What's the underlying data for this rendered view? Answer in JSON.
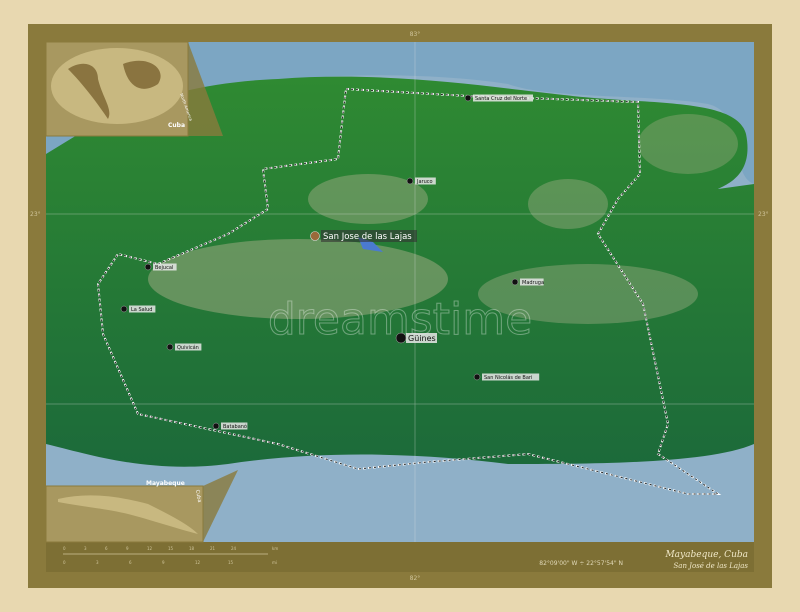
{
  "map": {
    "title": "Mayabeque, Cuba",
    "subtitle": "San José de las Lajas",
    "coordinates": "82°09'00\" W ÷ 22°57'54\" N",
    "capital": "San Jose de las Lajas",
    "cities": [
      {
        "name": "Santa Cruz del Norte"
      },
      {
        "name": "Jaruco"
      },
      {
        "name": "Bejucal"
      },
      {
        "name": "La Salud"
      },
      {
        "name": "Quivicán"
      },
      {
        "name": "Batabanó"
      },
      {
        "name": "Güines"
      },
      {
        "name": "Madruga"
      },
      {
        "name": "San Nicolás de Bari"
      }
    ],
    "ticks": {
      "top": "83°",
      "bottom": "82°",
      "left": "23°",
      "right": "23°"
    },
    "inset_world": {
      "label": "Cuba",
      "sublabel": "North America"
    },
    "inset_country": {
      "label": "Mayabeque",
      "sublabel": "Cuba"
    },
    "scale": {
      "km": [
        "0",
        "3",
        "6",
        "9",
        "12",
        "15",
        "18",
        "21",
        "24"
      ],
      "mi": [
        "0",
        "3",
        "6",
        "9",
        "12",
        "15"
      ],
      "km_unit": "km",
      "mi_unit": "mi"
    },
    "watermark": "dreamstime",
    "colors": {
      "sea": "#8fb0c8",
      "lowland": "#2e7a2e",
      "highland": "#9aaa80",
      "frame": "#8a7a3c"
    }
  }
}
